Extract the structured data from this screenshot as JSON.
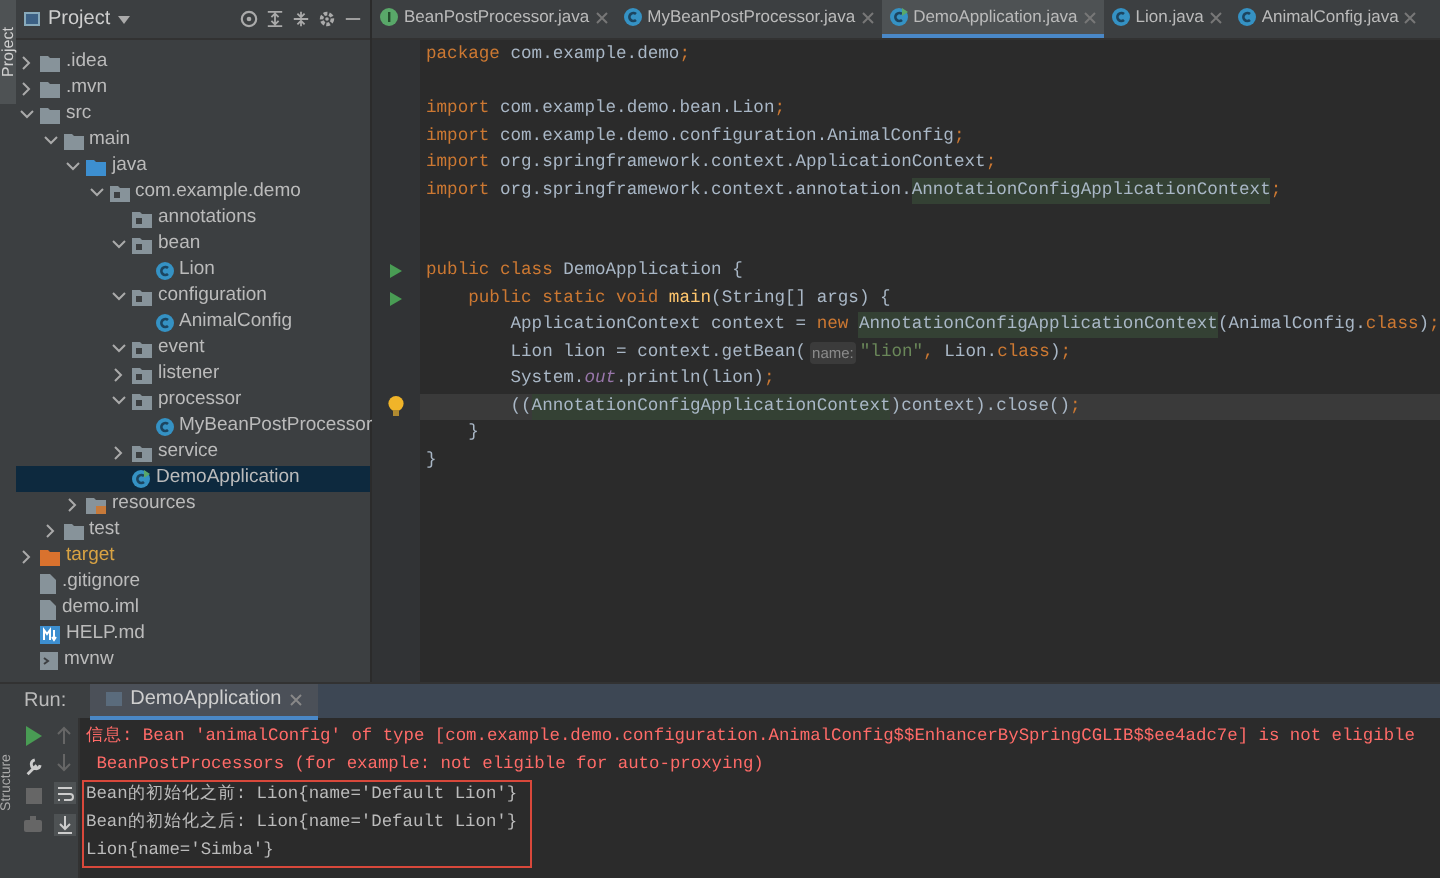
{
  "side_tabs": {
    "top": "Project",
    "bottom": "Structure"
  },
  "project_panel": {
    "title": "Project",
    "tree": [
      {
        "label": ".idea",
        "kind": "folder",
        "expanded": false,
        "selected": false
      },
      {
        "label": ".mvn",
        "kind": "folder",
        "expanded": false,
        "selected": false
      },
      {
        "label": "src",
        "kind": "folder",
        "expanded": true,
        "selected": false,
        "children": [
          {
            "label": "main",
            "kind": "folder",
            "expanded": true,
            "selected": false,
            "children": [
              {
                "label": "java",
                "kind": "source",
                "expanded": true,
                "selected": false,
                "children": [
                  {
                    "label": "com.example.demo",
                    "kind": "package",
                    "expanded": true,
                    "selected": false,
                    "children": [
                      {
                        "label": "annotations",
                        "kind": "package",
                        "selected": false
                      },
                      {
                        "label": "bean",
                        "kind": "package",
                        "expanded": true,
                        "selected": false,
                        "children": [
                          {
                            "label": "Lion",
                            "kind": "class",
                            "selected": false
                          }
                        ]
                      },
                      {
                        "label": "configuration",
                        "kind": "package",
                        "expanded": true,
                        "selected": false,
                        "children": [
                          {
                            "label": "AnimalConfig",
                            "kind": "class",
                            "selected": false
                          }
                        ]
                      },
                      {
                        "label": "event",
                        "kind": "package",
                        "expanded": true,
                        "selected": false
                      },
                      {
                        "label": "listener",
                        "kind": "package",
                        "expanded": false,
                        "selected": false
                      },
                      {
                        "label": "processor",
                        "kind": "package",
                        "expanded": true,
                        "selected": false,
                        "children": [
                          {
                            "label": "MyBeanPostProcessor",
                            "kind": "class",
                            "selected": false
                          }
                        ]
                      },
                      {
                        "label": "service",
                        "kind": "package",
                        "expanded": false,
                        "selected": false
                      },
                      {
                        "label": "DemoApplication",
                        "kind": "main-class",
                        "selected": true
                      }
                    ]
                  }
                ]
              },
              {
                "label": "resources",
                "kind": "resources",
                "expanded": false,
                "selected": false
              }
            ]
          },
          {
            "label": "test",
            "kind": "folder",
            "expanded": false,
            "selected": false
          }
        ]
      },
      {
        "label": "target",
        "kind": "excluded",
        "expanded": false,
        "selected": false
      },
      {
        "label": ".gitignore",
        "kind": "file",
        "selected": false
      },
      {
        "label": "demo.iml",
        "kind": "file",
        "selected": false
      },
      {
        "label": "HELP.md",
        "kind": "markdown",
        "selected": false
      },
      {
        "label": "mvnw",
        "kind": "script",
        "selected": false
      }
    ]
  },
  "editor_tabs": [
    {
      "label": "BeanPostProcessor.java",
      "kind": "interface",
      "selected": false
    },
    {
      "label": "MyBeanPostProcessor.java",
      "kind": "class",
      "selected": false
    },
    {
      "label": "DemoApplication.java",
      "kind": "main-class",
      "selected": true
    },
    {
      "label": "Lion.java",
      "kind": "class",
      "selected": false
    },
    {
      "label": "AnimalConfig.java",
      "kind": "class",
      "selected": false
    }
  ],
  "code": [
    {
      "current": false,
      "tokens": [
        {
          "kind": "keyword",
          "text": "package"
        },
        {
          "kind": "plain",
          "text": " com.example.demo"
        },
        {
          "kind": "keyword",
          "text": ";"
        }
      ]
    },
    {
      "current": false,
      "kind": "blank"
    },
    {
      "current": false,
      "tokens": [
        {
          "kind": "keyword",
          "text": "import"
        },
        {
          "kind": "plain",
          "text": " com.example.demo.bean.Lion"
        },
        {
          "kind": "keyword",
          "text": ";"
        }
      ]
    },
    {
      "current": false,
      "tokens": [
        {
          "kind": "keyword",
          "text": "import"
        },
        {
          "kind": "plain",
          "text": " com.example.demo.configuration.AnimalConfig"
        },
        {
          "kind": "keyword",
          "text": ";"
        }
      ]
    },
    {
      "current": false,
      "tokens": [
        {
          "kind": "keyword",
          "text": "import"
        },
        {
          "kind": "plain",
          "text": " org.springframework.context.ApplicationContext"
        },
        {
          "kind": "keyword",
          "text": ";"
        }
      ]
    },
    {
      "current": false,
      "tokens": [
        {
          "kind": "keyword",
          "text": "import"
        },
        {
          "kind": "plain",
          "text": " org.springframework.context.annotation."
        },
        {
          "kind": "usage",
          "text": "AnnotationConfigApplicationContext"
        },
        {
          "kind": "keyword",
          "text": ";"
        }
      ]
    },
    {
      "current": false,
      "kind": "blank"
    },
    {
      "current": false,
      "kind": "blank"
    },
    {
      "current": false,
      "kind": "run",
      "tokens": [
        {
          "kind": "keyword",
          "text": "public class"
        },
        {
          "kind": "plain",
          "text": " DemoApplication {"
        }
      ]
    },
    {
      "current": false,
      "kind": "run",
      "tokens": [
        {
          "kind": "keyword",
          "text": "    public static void "
        },
        {
          "kind": "method",
          "text": "main"
        },
        {
          "kind": "plain",
          "text": "(String[] args) {"
        }
      ]
    },
    {
      "current": false,
      "tokens": [
        {
          "kind": "plain",
          "text": "        ApplicationContext context = "
        },
        {
          "kind": "keyword",
          "text": "new "
        },
        {
          "kind": "usage",
          "text": "AnnotationConfigApplicationContext"
        },
        {
          "kind": "plain",
          "text": "(AnimalConfig."
        },
        {
          "kind": "keyword",
          "text": "class"
        },
        {
          "kind": "plain",
          "text": ")"
        },
        {
          "kind": "keyword",
          "text": ";"
        }
      ]
    },
    {
      "current": false,
      "tokens": [
        {
          "kind": "plain",
          "text": "        Lion lion = context.getBean("
        },
        {
          "kind": "hint",
          "text": "name:"
        },
        {
          "kind": "string",
          "text": "\"lion\""
        },
        {
          "kind": "keyword",
          "text": ","
        },
        {
          "kind": "plain",
          "text": " Lion."
        },
        {
          "kind": "keyword",
          "text": "class"
        },
        {
          "kind": "plain",
          "text": ")"
        },
        {
          "kind": "keyword",
          "text": ";"
        }
      ]
    },
    {
      "current": false,
      "tokens": [
        {
          "kind": "plain",
          "text": "        System."
        },
        {
          "kind": "field",
          "text": "out"
        },
        {
          "kind": "plain",
          "text": ".println(lion)"
        },
        {
          "kind": "keyword",
          "text": ";"
        }
      ]
    },
    {
      "current": true,
      "kind": "bulb",
      "tokens": [
        {
          "kind": "plain",
          "text": "        (("
        },
        {
          "kind": "usage",
          "text": "AnnotationConfigApplicationContext"
        },
        {
          "kind": "plain",
          "text": ")context).close()"
        },
        {
          "kind": "keyword",
          "text": ";"
        }
      ]
    },
    {
      "current": false,
      "tokens": [
        {
          "kind": "plain",
          "text": "    }"
        }
      ]
    },
    {
      "current": false,
      "tokens": [
        {
          "kind": "plain",
          "text": "}"
        }
      ]
    }
  ],
  "run_panel": {
    "label": "Run:",
    "tab": "DemoApplication",
    "output": [
      {
        "kind": "error",
        "boxed": false,
        "text": "信息: Bean 'animalConfig' of type [com.example.demo.configuration.AnimalConfig$$EnhancerBySpringCGLIB$$ee4adc7e] is not eligible"
      },
      {
        "kind": "error",
        "boxed": false,
        "text": " BeanPostProcessors (for example: not eligible for auto-proxying)"
      },
      {
        "kind": "normal",
        "boxed": true,
        "text": "Bean的初始化之前: Lion{name='Default Lion'}"
      },
      {
        "kind": "normal",
        "boxed": true,
        "text": "Bean的初始化之后: Lion{name='Default Lion'}"
      },
      {
        "kind": "normal",
        "boxed": true,
        "text": "Lion{name='Simba'}"
      }
    ]
  }
}
